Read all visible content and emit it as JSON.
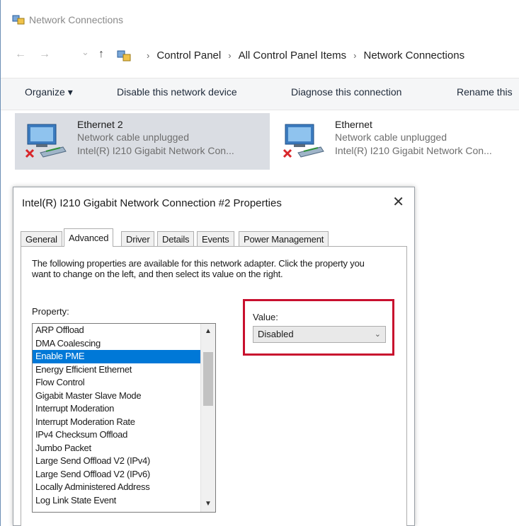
{
  "explorer": {
    "title": "Network Connections",
    "breadcrumb": [
      "Control Panel",
      "All Control Panel Items",
      "Network Connections"
    ],
    "nav": {
      "back": "←",
      "forward": "→",
      "recent": "⌄",
      "up": "↑",
      "separator": "›"
    },
    "commands": {
      "organize": "Organize ▾",
      "disable": "Disable this network device",
      "diagnose": "Diagnose this connection",
      "rename": "Rename this"
    },
    "adapters": [
      {
        "name": "Ethernet 2",
        "status": "Network cable unplugged",
        "device": "Intel(R) I210 Gigabit Network Con...",
        "selected": true
      },
      {
        "name": "Ethernet",
        "status": "Network cable unplugged",
        "device": "Intel(R) I210 Gigabit Network Con...",
        "selected": false
      }
    ]
  },
  "dialog": {
    "title": "Intel(R) I210 Gigabit Network Connection #2 Properties",
    "close": "✕",
    "tabs": [
      "General",
      "Advanced",
      "Driver",
      "Details",
      "Events",
      "Power Management"
    ],
    "active_tab": "Advanced",
    "description": "The following properties are available for this network adapter. Click the property you want to change on the left, and then select its value on the right.",
    "property_label": "Property:",
    "properties": [
      "ARP Offload",
      "DMA Coalescing",
      "Enable PME",
      "Energy Efficient Ethernet",
      "Flow Control",
      "Gigabit Master Slave Mode",
      "Interrupt Moderation",
      "Interrupt Moderation Rate",
      "IPv4 Checksum Offload",
      "Jumbo Packet",
      "Large Send Offload V2 (IPv4)",
      "Large Send Offload V2 (IPv6)",
      "Locally Administered Address",
      "Log Link State Event"
    ],
    "selected_property": "Enable PME",
    "scroll_up": "▲",
    "scroll_down": "▼",
    "value_label": "Value:",
    "value": "Disabled",
    "chevron": "⌄"
  },
  "colors": {
    "selection": "#0078d7",
    "highlight_box": "#c8102e",
    "selected_adapter": "#dadde3"
  },
  "icons": [
    "network-connections-icon",
    "control-panel-icon",
    "ethernet-adapter-icon",
    "disconnected-x-icon",
    "close-icon",
    "chevron-down-icon",
    "scroll-up-icon",
    "scroll-down-icon"
  ]
}
